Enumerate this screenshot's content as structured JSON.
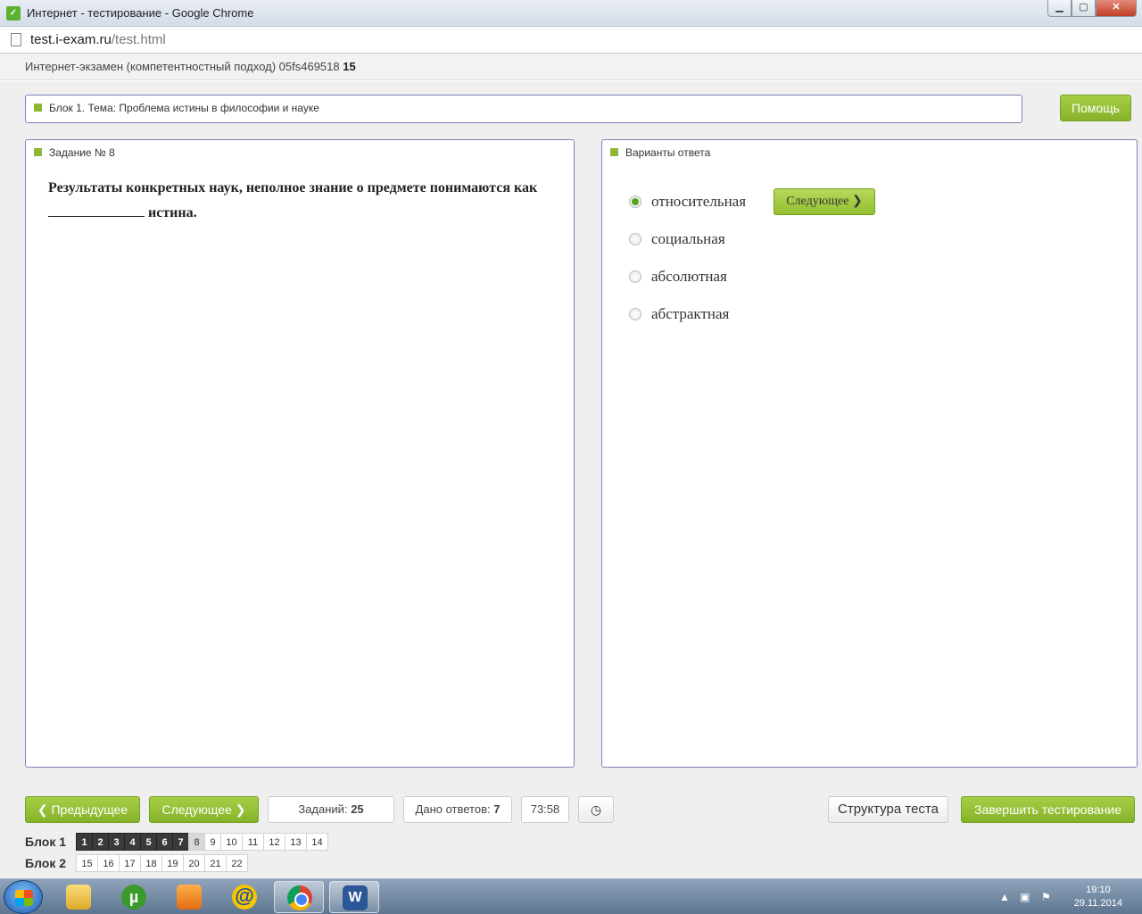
{
  "window": {
    "title": "Интернет - тестирование - Google Chrome",
    "minimize": "▁",
    "maximize": "▢",
    "close": "✕"
  },
  "address": {
    "domain": "test.i-exam.ru",
    "path": "/test.html"
  },
  "exam": {
    "title": "Интернет-экзамен (компетентностный подход) 05fs469518",
    "number": "15"
  },
  "block": {
    "label": "Блок 1. Тема: Проблема истины в философии и науке"
  },
  "help_label": "Помощь",
  "task": {
    "label": "Задание № 8",
    "question_part1": "Результаты конкретных наук, неполное знание о предмете понимаются как",
    "question_part2": "истина."
  },
  "answers": {
    "label": "Варианты ответа",
    "options": [
      {
        "text": "относительная",
        "selected": true
      },
      {
        "text": "социальная",
        "selected": false
      },
      {
        "text": "абсолютная",
        "selected": false
      },
      {
        "text": "абстрактная",
        "selected": false
      }
    ],
    "next_label": "Следующее"
  },
  "toolbar": {
    "prev_label": "Предыдущее",
    "next_label": "Следующее",
    "tasks_label": "Заданий:",
    "tasks_count": "25",
    "answered_label": "Дано ответов:",
    "answered_count": "7",
    "timer": "73:58",
    "structure_label": "Структура теста",
    "finish_label": "Завершить тестирование"
  },
  "nav": {
    "block1_label": "Блок 1",
    "block1_items": [
      "1",
      "2",
      "3",
      "4",
      "5",
      "6",
      "7",
      "8",
      "9",
      "10",
      "11",
      "12",
      "13",
      "14"
    ],
    "block1_done": 7,
    "block1_current": "8",
    "block2_label": "Блок 2",
    "block2_items": [
      "15",
      "16",
      "17",
      "18",
      "19",
      "20",
      "21",
      "22"
    ]
  },
  "taskbar": {
    "time": "19:10",
    "date": "29.11.2014"
  },
  "colors": {
    "accent_green": "#8db735",
    "panel_border": "#7b84b8",
    "selected_radio": "#5aa51e"
  }
}
